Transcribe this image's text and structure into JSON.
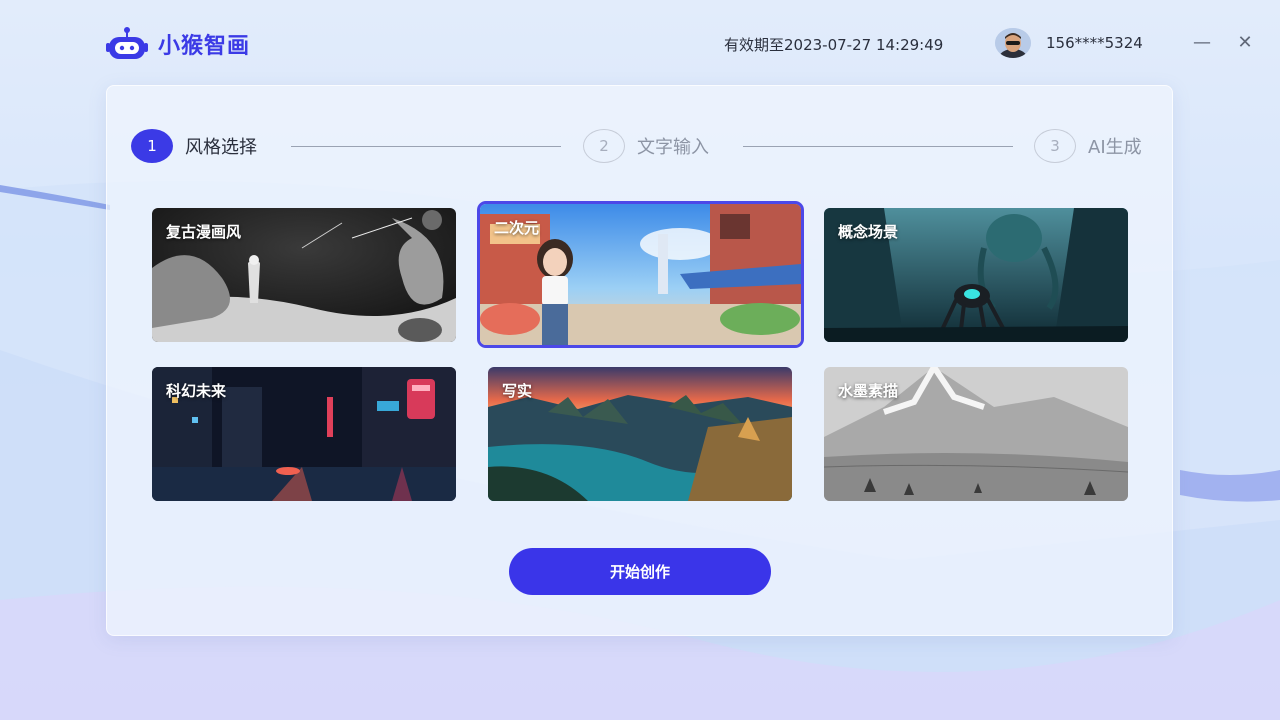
{
  "app": {
    "name": "小猴智画",
    "logo_icon": "robot-icon",
    "accent": "#3b3ae6"
  },
  "header": {
    "expiry_text": "有效期至2023-07-27 14:29:49",
    "phone": "156****5324",
    "minimize_icon": "minimize-icon",
    "close_icon": "close-icon",
    "minimize_glyph": "—",
    "close_glyph": "✕"
  },
  "stepper": {
    "steps": [
      {
        "num": "1",
        "label": "风格选择",
        "active": true
      },
      {
        "num": "2",
        "label": "文字输入",
        "active": false
      },
      {
        "num": "3",
        "label": "AI生成",
        "active": false
      }
    ]
  },
  "styles": [
    {
      "label": "复古漫画风",
      "selected": false
    },
    {
      "label": "二次元",
      "selected": true
    },
    {
      "label": "概念场景",
      "selected": false
    },
    {
      "label": "科幻未来",
      "selected": false
    },
    {
      "label": "写实",
      "selected": false
    },
    {
      "label": "水墨素描",
      "selected": false
    }
  ],
  "actions": {
    "start_label": "开始创作"
  }
}
